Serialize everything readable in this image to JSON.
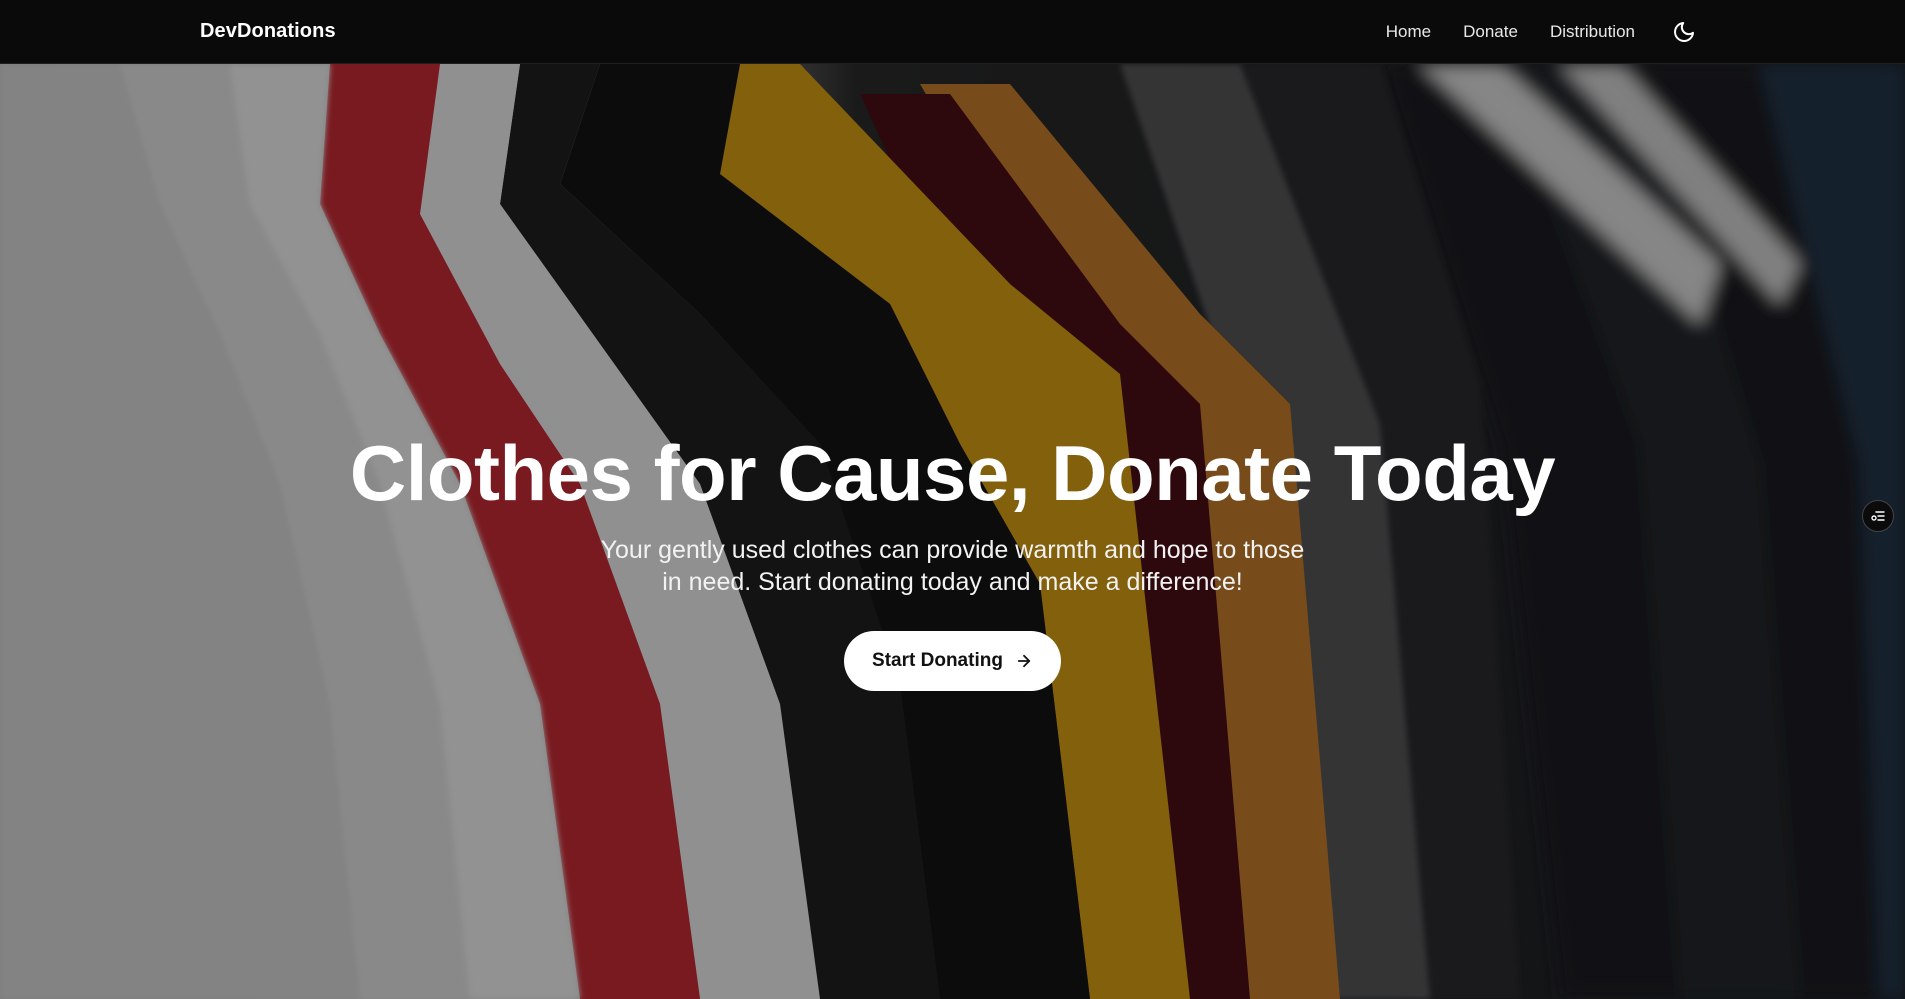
{
  "brand": {
    "name": "DevDonations"
  },
  "nav": {
    "items": [
      {
        "label": "Home"
      },
      {
        "label": "Donate"
      },
      {
        "label": "Distribution"
      }
    ],
    "theme_toggle_icon": "moon-icon"
  },
  "hero": {
    "background_image": "rack of hanging t-shirts (white, red, grey, black, yellow, maroon, orange)",
    "title": "Clothes for Cause, Donate Today",
    "subtitle": "Your gently used clothes can provide warmth and hope to those in need. Start donating today and make a difference!",
    "cta_label": "Start Donating",
    "cta_icon": "arrow-right-icon"
  },
  "side_widget": {
    "icon": "list-settings-icon"
  },
  "colors": {
    "navbar_bg": "#0a0a0a",
    "cta_bg": "#ffffff",
    "text_light": "#ffffff"
  }
}
